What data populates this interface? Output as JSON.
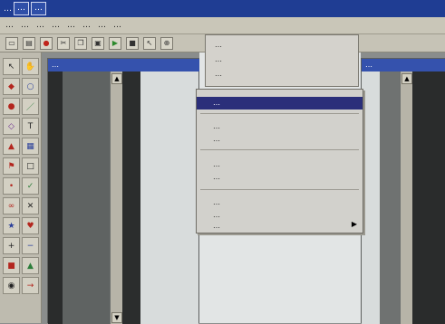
{
  "window": {
    "title": "…",
    "title_segments": [
      "…",
      "…"
    ]
  },
  "menubar": [
    "…",
    "…",
    "…",
    "…",
    "…",
    "…",
    "…",
    "…"
  ],
  "child_windows": [
    {
      "title": "…"
    },
    {
      "title": "…"
    }
  ],
  "top_menu": {
    "items": [
      "…",
      "…",
      "…"
    ]
  },
  "dropdown": {
    "highlighted": "…",
    "items": [
      "…",
      "…",
      "…",
      "…",
      "…",
      "…",
      "…"
    ]
  },
  "colors": {
    "titlebar": "#1f3d93",
    "highlight": "#2b2f7a",
    "chrome": "#c9c6b8"
  },
  "icons": [
    "new-icon",
    "open-icon",
    "save-icon",
    "cut-icon",
    "copy-icon",
    "paste-icon",
    "run-icon",
    "stop-icon",
    "pointer-tool-icon",
    "zoom-tool-icon"
  ]
}
